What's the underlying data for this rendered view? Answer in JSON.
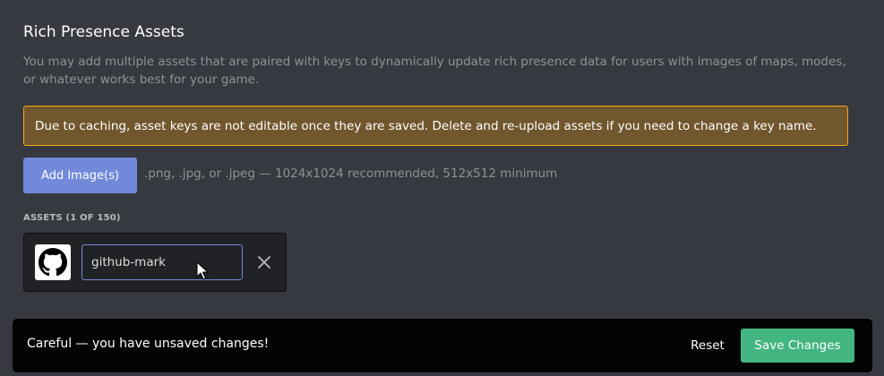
{
  "section": {
    "title": "Rich Presence Assets",
    "description": "You may add multiple assets that are paired with keys to dynamically update rich presence data for users with images of maps, modes, or whatever works best for your game."
  },
  "warning": {
    "text": "Due to caching, asset keys are not editable once they are saved. Delete and re-upload assets if you need to change a key name."
  },
  "upload": {
    "button_label": "Add Image(s)",
    "hint": ".png, .jpg, or .jpeg — 1024x1024 recommended, 512x512 minimum"
  },
  "assets": {
    "label": "ASSETS (1 OF 150)",
    "items": [
      {
        "key": "github-mark",
        "thumbnail_icon": "github-mark-icon"
      }
    ]
  },
  "unsaved_notice": {
    "text": "Careful — you have unsaved changes!",
    "reset_label": "Reset",
    "save_label": "Save Changes"
  },
  "colors": {
    "background": "#36393f",
    "warning_bg": "#70572e",
    "warning_border": "#faa61a",
    "brand": "#7289da",
    "save_green": "#43b581",
    "notice_bg": "#040405"
  }
}
